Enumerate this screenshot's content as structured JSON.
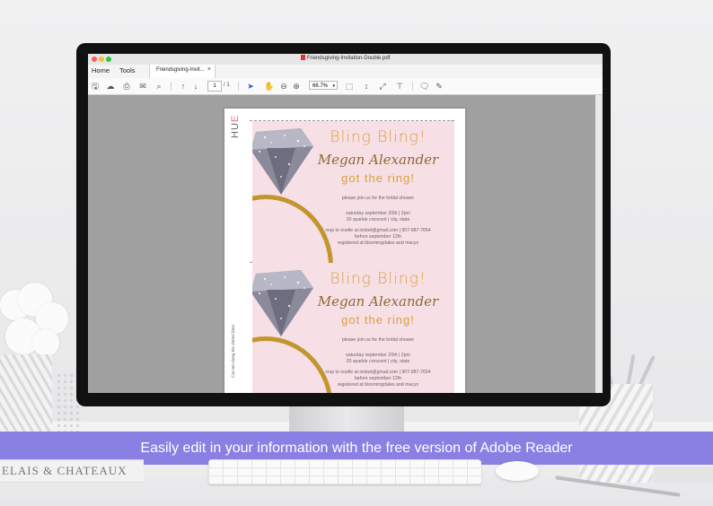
{
  "window": {
    "title": "Friendsgiving-Invitation-Double.pdf"
  },
  "menu": {
    "home": "Home",
    "tools": "Tools"
  },
  "tab": {
    "label": "Friendsgiving-Invit...",
    "close": "×"
  },
  "toolbar": {
    "page_current": "1",
    "page_total": "/ 1",
    "zoom": "66.7%",
    "icons": [
      "save-icon",
      "upload-icon",
      "print-icon",
      "email-icon",
      "search-icon",
      "page-up-icon",
      "page-down-icon",
      "select-icon",
      "hand-icon",
      "zoom-out-icon",
      "zoom-in-icon",
      "fit-page-icon",
      "scroll-icon",
      "fullscreen-icon",
      "fill-sign-icon",
      "comment-icon",
      "pen-icon"
    ]
  },
  "document": {
    "brand_prefix": "HU",
    "brand_accent": "E",
    "cut_note": "Cut out along the dotted lines",
    "invitations": [
      {
        "headline": "Bling Bling!",
        "name": "Megan Alexander",
        "tagline": "got the ring!",
        "invite_line": "please join us for the bridal shower",
        "date_line": "saturday september 20th | 2pm",
        "address_line": "20 sparkle crescent | city, state",
        "rsvp_line": "rsvp to noelle at nisbet@gmail.com | 907-987-7654",
        "before_line": "before september 12th",
        "registry_line": "registered at bloomingdales and macys"
      },
      {
        "headline": "Bling Bling!",
        "name": "Megan Alexander",
        "tagline": "got the ring!",
        "invite_line": "please join us for the bridal shower",
        "date_line": "saturday september 20th | 2pm",
        "address_line": "20 sparkle crescent | city, state",
        "rsvp_line": "rsvp to noelle at nisbet@gmail.com | 907-987-7654",
        "before_line": "before september 12th",
        "registry_line": "registered at bloomingdales and macys"
      }
    ]
  },
  "scene": {
    "book_text": "ELAIS & CHATEAUX"
  },
  "caption": "Easily edit in your information with the free version of Adobe Reader",
  "colors": {
    "caption_band": "#8a80e4",
    "invite_bg": "#f7dfe6",
    "gold": "#c2952f",
    "canvas_gray": "#a0a0a0"
  }
}
